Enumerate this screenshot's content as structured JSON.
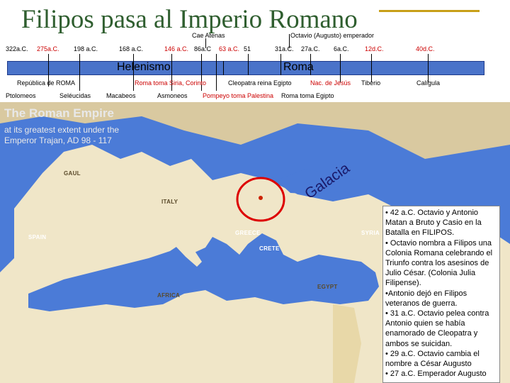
{
  "title": "Filipos pasa al Imperio Romano",
  "events_top": {
    "cae_atenas": "Cae Atenas",
    "octavio": "Octavio (Augusto) emperador"
  },
  "years": [
    {
      "label": "322a.C.",
      "color": "#000000"
    },
    {
      "label": "275a.C.",
      "color": "#cc0000"
    },
    {
      "label": "198 a.C.",
      "color": "#000000"
    },
    {
      "label": "168 a.C.",
      "color": "#000000"
    },
    {
      "label": "146 a.C.",
      "color": "#cc0000"
    },
    {
      "label": "86a.C",
      "color": "#000000"
    },
    {
      "label": "63 a.C.",
      "color": "#cc0000"
    },
    {
      "label": "51",
      "color": "#000000"
    },
    {
      "label": "31a.C.",
      "color": "#000000"
    },
    {
      "label": "27a.C.",
      "color": "#000000"
    },
    {
      "label": "6a.C.",
      "color": "#000000"
    },
    {
      "label": "12d.C.",
      "color": "#cc0000"
    },
    {
      "label": "40d.C.",
      "color": "#cc0000"
    }
  ],
  "periods": {
    "helenismo": "Helenismo",
    "roma": "Roma"
  },
  "below_labels": [
    {
      "label": "República de ROMA",
      "color": "#000000"
    },
    {
      "label": "Roma toma Siria, Corinto",
      "color": "#cc0000"
    },
    {
      "label": "Cleopatra reina Egipto",
      "color": "#000000"
    },
    {
      "label": "Nac. de Jesús",
      "color": "#cc0000"
    },
    {
      "label": "Tiberio",
      "color": "#000000"
    },
    {
      "label": "Calígula",
      "color": "#000000"
    },
    {
      "label": "Ptolomeos",
      "color": "#000000"
    },
    {
      "label": "Seléucidas",
      "color": "#000000"
    },
    {
      "label": "Macabeos",
      "color": "#000000"
    },
    {
      "label": "Asmoneos",
      "color": "#000000"
    },
    {
      "label": "Pompeyo toma Palestina",
      "color": "#cc0000"
    },
    {
      "label": "Roma toma Egipto",
      "color": "#000000"
    }
  ],
  "map": {
    "title": "The Roman Empire",
    "subtitle_1": "at its greatest extent under the",
    "subtitle_2": "Emperor Trajan, AD 98 - 117",
    "galacia": "Galacia",
    "regions": [
      "GAUL",
      "ITALY",
      "SPAIN",
      "GREECE",
      "CRETE",
      "AFRICA",
      "EGYPT",
      "SYRIA"
    ]
  },
  "notes": [
    "• 42 a.C. Octavio y Antonio Matan a Bruto y Casio en la Batalla en FILIPOS.",
    "• Octavio nombra a Filipos una Colonia Romana celebrando el Triunfo contra los asesinos de Julio César. (Colonia Julia Filipense).",
    "•Antonio dejó en Filipos veteranos de guerra.",
    "• 31 a.C. Octavio pelea contra Antonio quien se había enamorado de Cleopatra y ambos se suicidan.",
    "• 29 a.C. Octavio cambia el nombre a César Augusto",
    "• 27 a.C. Emperador Augusto"
  ],
  "colors": {
    "title": "#2f5e2f",
    "timeline": "#4a73c9",
    "sea": "#4b7bd7",
    "empire": "#f0e6c8",
    "highlight_circle": "#dd0000",
    "gold_rule": "#c8a018"
  }
}
